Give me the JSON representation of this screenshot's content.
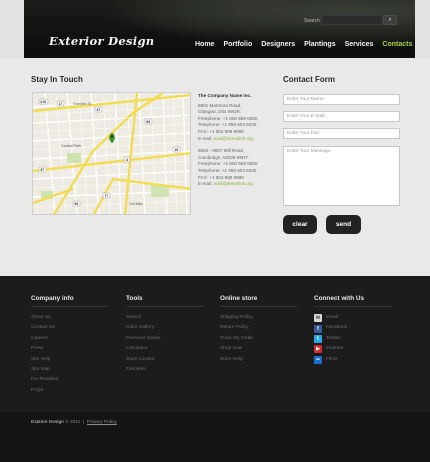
{
  "header": {
    "logo": "Exterior Design",
    "search_label": "Search",
    "nav": [
      "Home",
      "Portfolio",
      "Designers",
      "Plantings",
      "Services",
      "Contacts"
    ],
    "active_nav": "Contacts"
  },
  "main": {
    "stay_title": "Stay In Touch",
    "contact_title": "Contact Form",
    "address1": {
      "company": "The Company Name Inc.",
      "lines": [
        "8901 Marmora Road,",
        "Glasgow, D04 89GR.",
        "Freephone: +1 800 559 6580",
        "Telephone: +1 959 603 6035",
        "FAX: +1 504 889 9898"
      ],
      "email_label": "E-mail:",
      "email": "mail@demolink.org"
    },
    "address2": {
      "lines": [
        "9863 - 9867 Mill Road,",
        "Cambridge, MG09 99HT.",
        "Freephone: +1 800 559 6580",
        "Telephone: +1 959 603 6035",
        "FAX: +1 504 889 9898"
      ],
      "email_label": "E-mail:",
      "email": "mail@demolink.org"
    },
    "form": {
      "name_placeholder": "Enter Your Name:",
      "email_placeholder": "Enter Your E-mail:",
      "fax_placeholder": "Enter Your Fax:",
      "message_placeholder": "Enter Your Message:",
      "clear_label": "clear",
      "send_label": "send"
    },
    "map_labels": {
      "road_labels": [
        "Grandier St",
        "Central Park",
        "Old Mills"
      ],
      "road_numbers": [
        "215",
        "17",
        "47",
        "83",
        "57",
        "4",
        "77",
        "15",
        "59"
      ]
    }
  },
  "footer": {
    "company_title": "Company info",
    "company_items": [
      "About Us",
      "Contact Us",
      "Careers",
      "Press",
      "Site Help",
      "Site Map",
      "For Retailers",
      "FAQs"
    ],
    "tools_title": "Tools",
    "tools_items": [
      "Search",
      "Color Gallery",
      "Personal Viewer",
      "Calculator",
      "Store Locator",
      "Favorites"
    ],
    "store_title": "Online store",
    "store_items": [
      "Shipping Policy",
      "Return Policy",
      "Track My Order",
      "Shop Now",
      "Store Help"
    ],
    "connect_title": "Connect with Us",
    "social": [
      {
        "label": "Email",
        "icon": "email-icon",
        "color": "#d9d9d9"
      },
      {
        "label": "Facebook",
        "icon": "facebook-icon",
        "color": "#3b5998"
      },
      {
        "label": "Twitter",
        "icon": "twitter-icon",
        "color": "#29a9e1"
      },
      {
        "label": "Youtube",
        "icon": "youtube-icon",
        "color": "#cc2b2b"
      },
      {
        "label": "Flickr",
        "icon": "flickr-icon",
        "color": "#1b6fd1"
      }
    ],
    "copyright_brand": "Exterior Design",
    "copyright_year": "© 2011",
    "separator": "|",
    "privacy": "Privacy Policy"
  },
  "colors": {
    "accent": "#a8d43a",
    "email_green": "#8ab62e",
    "footer_bg": "#1c1c1c"
  }
}
